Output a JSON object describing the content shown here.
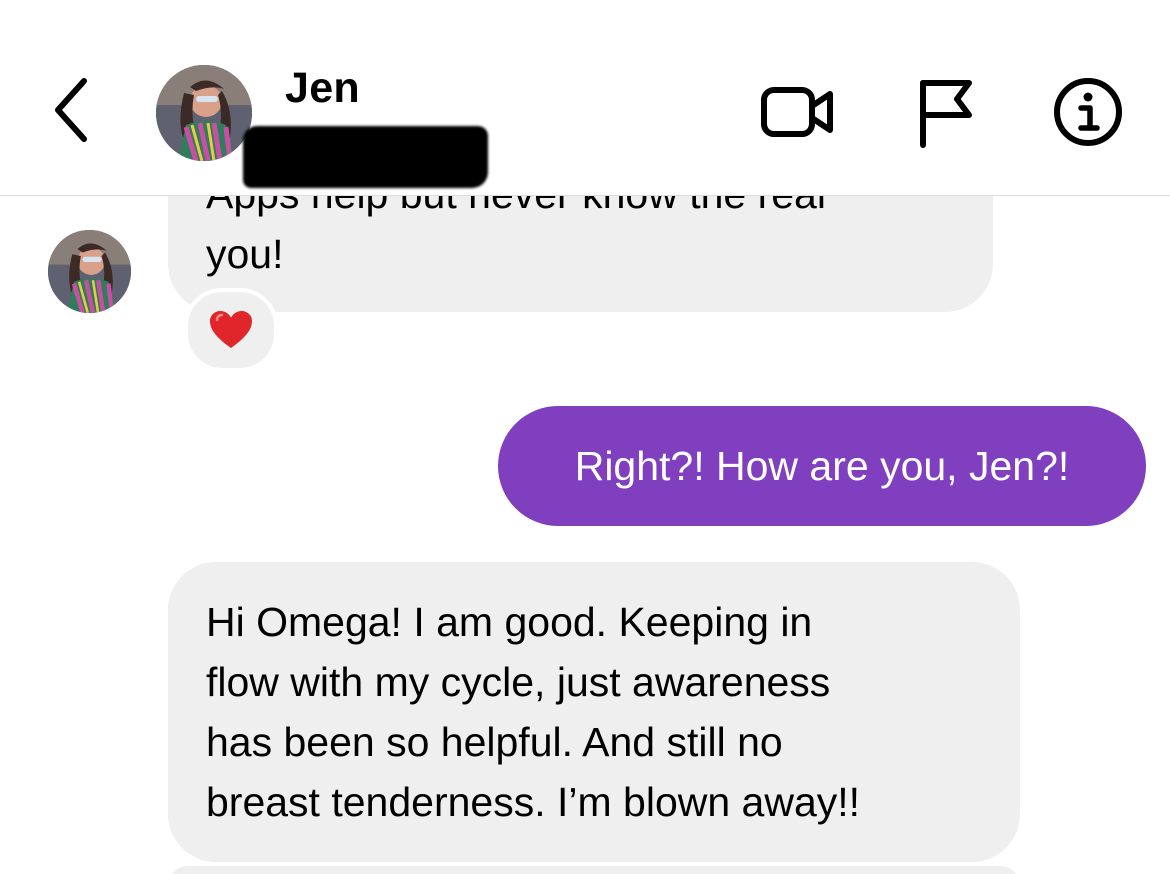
{
  "header": {
    "contact_name": "Jen",
    "back_icon": "chevron-left-icon",
    "actions": [
      {
        "name": "video-call",
        "icon": "video-camera-icon"
      },
      {
        "name": "report",
        "icon": "flag-icon"
      },
      {
        "name": "details",
        "icon": "info-icon"
      }
    ]
  },
  "messages": {
    "m1": {
      "partial_line": "Apps help but never know the real",
      "last_line": "you!",
      "reaction": "❤️"
    },
    "m2": {
      "text": "Right?! How are you, Jen?!"
    },
    "m3": {
      "lines": [
        "Hi Omega! I am good. Keeping in",
        "flow with my cycle, just awareness",
        "has been so helpful. And still no",
        "breast tenderness. I’m blown away!!"
      ]
    }
  },
  "colors": {
    "outgoing_bubble": "#7f3fbf",
    "incoming_bubble": "#efefef",
    "header_divider": "#dcdcdc"
  }
}
